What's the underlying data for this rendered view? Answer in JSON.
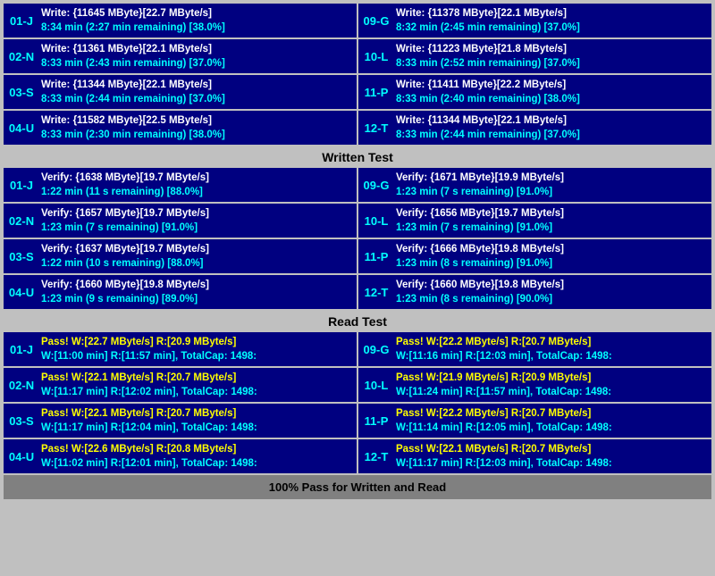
{
  "sections": {
    "write": {
      "rows": [
        {
          "left": {
            "label": "01-J",
            "line1": "Write: {11645 MByte}[22.7 MByte/s]",
            "line2": "8:34 min (2:27 min remaining)  [38.0%]"
          },
          "right": {
            "label": "09-G",
            "line1": "Write: {11378 MByte}[22.1 MByte/s]",
            "line2": "8:32 min (2:45 min remaining)  [37.0%]"
          }
        },
        {
          "left": {
            "label": "02-N",
            "line1": "Write: {11361 MByte}[22.1 MByte/s]",
            "line2": "8:33 min (2:43 min remaining)  [37.0%]"
          },
          "right": {
            "label": "10-L",
            "line1": "Write: {11223 MByte}[21.8 MByte/s]",
            "line2": "8:33 min (2:52 min remaining)  [37.0%]"
          }
        },
        {
          "left": {
            "label": "03-S",
            "line1": "Write: {11344 MByte}[22.1 MByte/s]",
            "line2": "8:33 min (2:44 min remaining)  [37.0%]"
          },
          "right": {
            "label": "11-P",
            "line1": "Write: {11411 MByte}[22.2 MByte/s]",
            "line2": "8:33 min (2:40 min remaining)  [38.0%]"
          }
        },
        {
          "left": {
            "label": "04-U",
            "line1": "Write: {11582 MByte}[22.5 MByte/s]",
            "line2": "8:33 min (2:30 min remaining)  [38.0%]"
          },
          "right": {
            "label": "12-T",
            "line1": "Write: {11344 MByte}[22.1 MByte/s]",
            "line2": "8:33 min (2:44 min remaining)  [37.0%]"
          }
        }
      ]
    },
    "written_header": "Written Test",
    "verify": {
      "rows": [
        {
          "left": {
            "label": "01-J",
            "line1": "Verify: {1638 MByte}[19.7 MByte/s]",
            "line2": "1:22 min (11 s remaining)   [88.0%]"
          },
          "right": {
            "label": "09-G",
            "line1": "Verify: {1671 MByte}[19.9 MByte/s]",
            "line2": "1:23 min (7 s remaining)   [91.0%]"
          }
        },
        {
          "left": {
            "label": "02-N",
            "line1": "Verify: {1657 MByte}[19.7 MByte/s]",
            "line2": "1:23 min (7 s remaining)   [91.0%]"
          },
          "right": {
            "label": "10-L",
            "line1": "Verify: {1656 MByte}[19.7 MByte/s]",
            "line2": "1:23 min (7 s remaining)   [91.0%]"
          }
        },
        {
          "left": {
            "label": "03-S",
            "line1": "Verify: {1637 MByte}[19.7 MByte/s]",
            "line2": "1:22 min (10 s remaining)   [88.0%]"
          },
          "right": {
            "label": "11-P",
            "line1": "Verify: {1666 MByte}[19.8 MByte/s]",
            "line2": "1:23 min (8 s remaining)   [91.0%]"
          }
        },
        {
          "left": {
            "label": "04-U",
            "line1": "Verify: {1660 MByte}[19.8 MByte/s]",
            "line2": "1:23 min (9 s remaining)   [89.0%]"
          },
          "right": {
            "label": "12-T",
            "line1": "Verify: {1660 MByte}[19.8 MByte/s]",
            "line2": "1:23 min (8 s remaining)   [90.0%]"
          }
        }
      ]
    },
    "read_header": "Read Test",
    "pass": {
      "rows": [
        {
          "left": {
            "label": "01-J",
            "line1": "Pass! W:[22.7 MByte/s] R:[20.9 MByte/s]",
            "line2": "W:[11:00 min] R:[11:57 min], TotalCap: 1498:"
          },
          "right": {
            "label": "09-G",
            "line1": "Pass! W:[22.2 MByte/s] R:[20.7 MByte/s]",
            "line2": "W:[11:16 min] R:[12:03 min], TotalCap: 1498:"
          }
        },
        {
          "left": {
            "label": "02-N",
            "line1": "Pass! W:[22.1 MByte/s] R:[20.7 MByte/s]",
            "line2": "W:[11:17 min] R:[12:02 min], TotalCap: 1498:"
          },
          "right": {
            "label": "10-L",
            "line1": "Pass! W:[21.9 MByte/s] R:[20.9 MByte/s]",
            "line2": "W:[11:24 min] R:[11:57 min], TotalCap: 1498:"
          }
        },
        {
          "left": {
            "label": "03-S",
            "line1": "Pass! W:[22.1 MByte/s] R:[20.7 MByte/s]",
            "line2": "W:[11:17 min] R:[12:04 min], TotalCap: 1498:"
          },
          "right": {
            "label": "11-P",
            "line1": "Pass! W:[22.2 MByte/s] R:[20.7 MByte/s]",
            "line2": "W:[11:14 min] R:[12:05 min], TotalCap: 1498:"
          }
        },
        {
          "left": {
            "label": "04-U",
            "line1": "Pass! W:[22.6 MByte/s] R:[20.8 MByte/s]",
            "line2": "W:[11:02 min] R:[12:01 min], TotalCap: 1498:"
          },
          "right": {
            "label": "12-T",
            "line1": "Pass! W:[22.1 MByte/s] R:[20.7 MByte/s]",
            "line2": "W:[11:17 min] R:[12:03 min], TotalCap: 1498:"
          }
        }
      ]
    },
    "footer": "100% Pass for Written and Read"
  }
}
